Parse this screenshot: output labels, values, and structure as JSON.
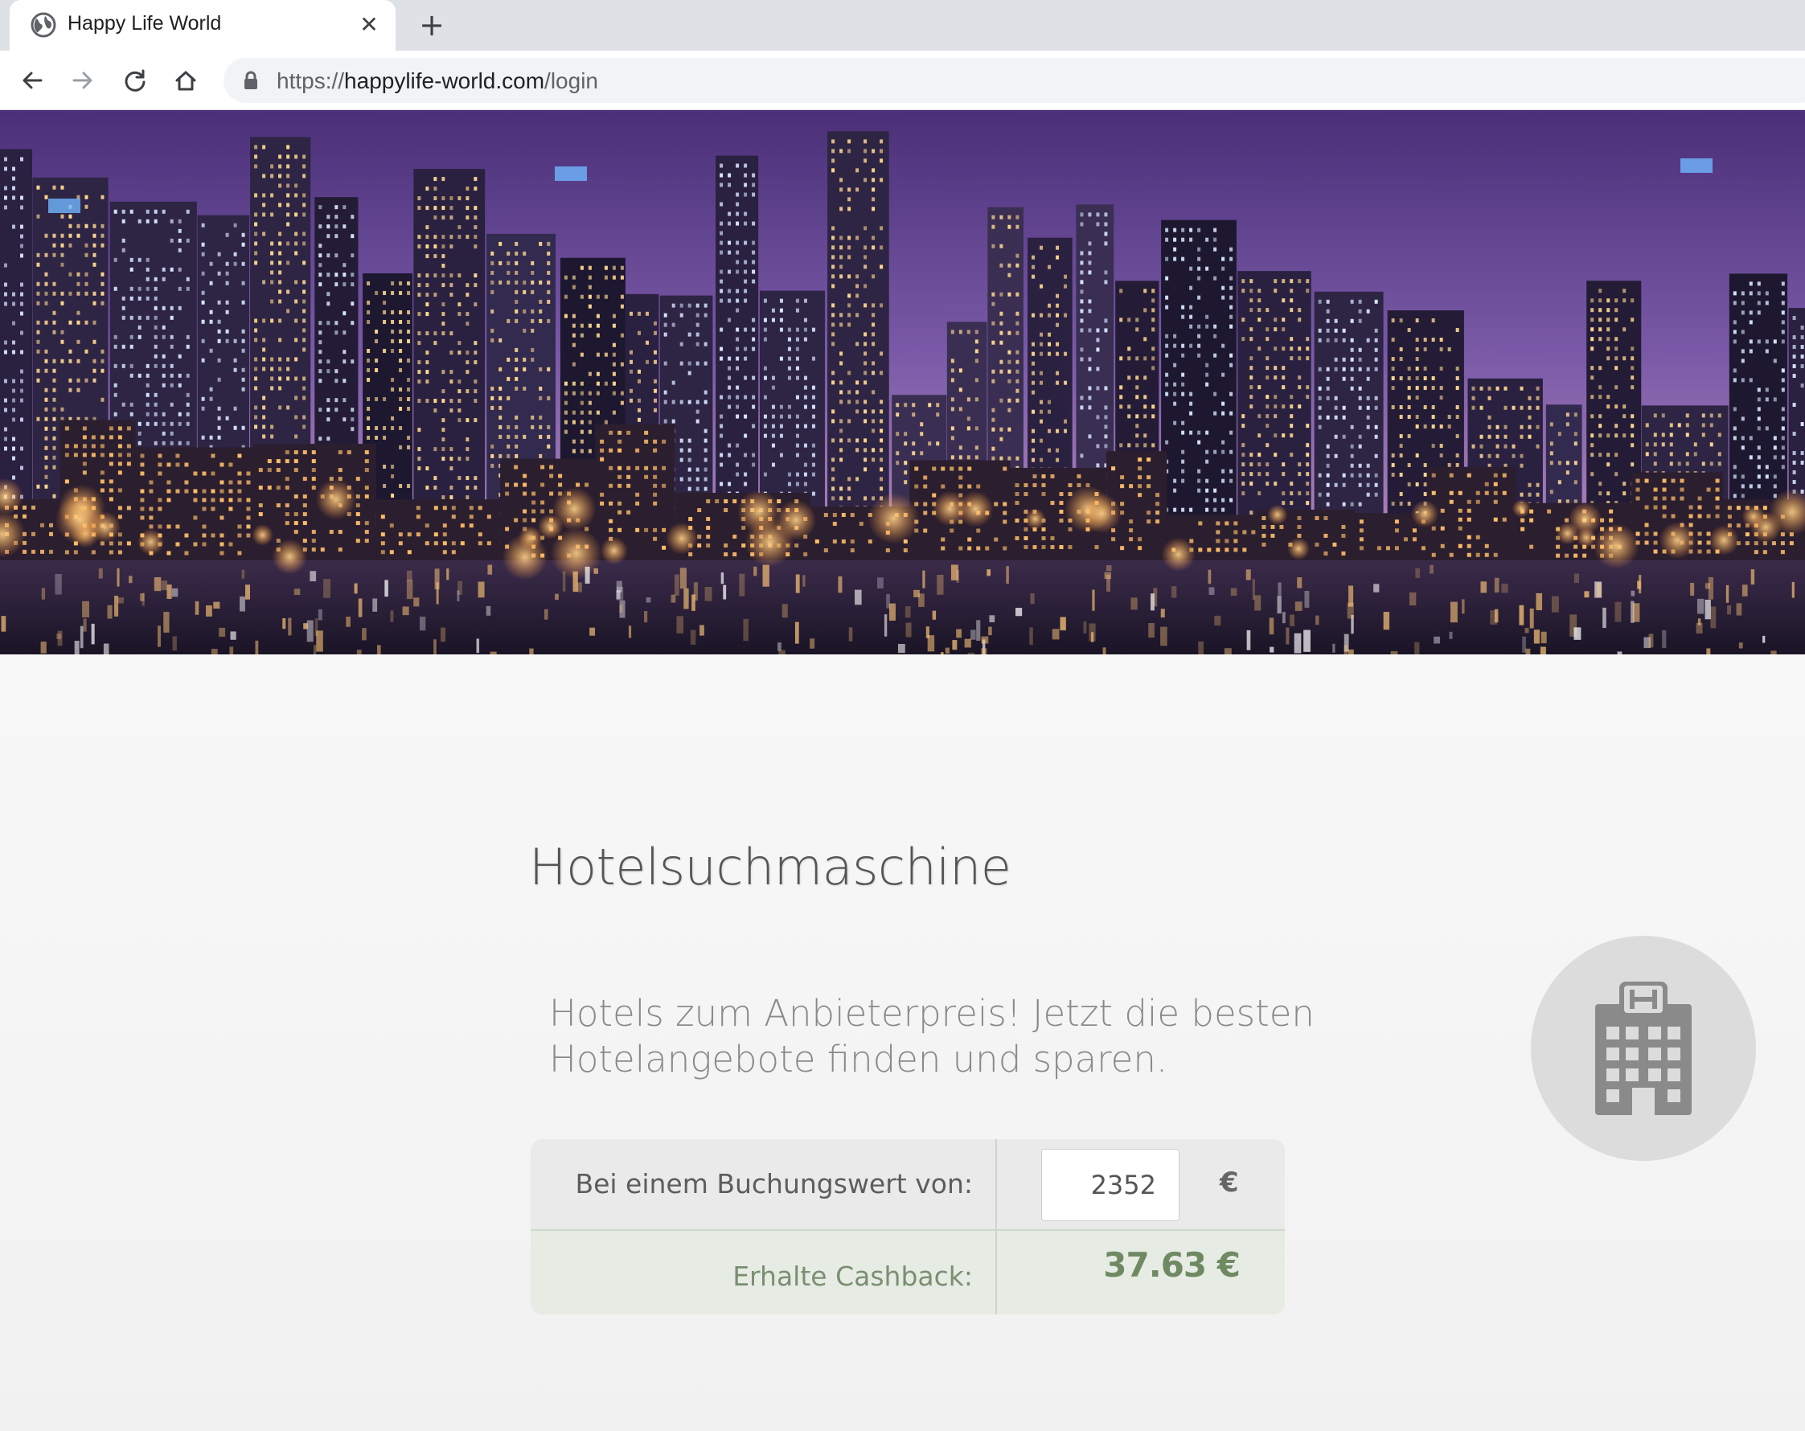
{
  "browser": {
    "tab": {
      "title": "Happy Life World",
      "favicon": "globe-icon",
      "close_icon": "close-icon"
    },
    "new_tab_icon": "plus-icon",
    "nav": {
      "back_icon": "back-arrow-icon",
      "forward_icon": "forward-arrow-icon",
      "reload_icon": "reload-icon",
      "home_icon": "home-icon"
    },
    "address": {
      "lock_icon": "lock-icon",
      "scheme": "https://",
      "host": "happylife-world.com",
      "path": "/login"
    }
  },
  "hero": {
    "image": "city-skyline-night-photo"
  },
  "main": {
    "title": "Hotelsuchmaschine",
    "subtitle_line1": "Hotels zum Anbieterpreis! Jetzt die besten",
    "subtitle_line2": "Hotelangebote finden und sparen.",
    "hotel_icon": "hotel-building-icon",
    "calculator": {
      "booking_label": "Bei einem Buchungswert von:",
      "booking_value": "2352",
      "currency": "€",
      "cashback_label": "Erhalte Cashback:",
      "cashback_value": "37.63 €"
    }
  },
  "colors": {
    "accent_green": "#6f8a63",
    "chrome_bg": "#dee1e6",
    "page_bg": "#f3f3f3"
  }
}
